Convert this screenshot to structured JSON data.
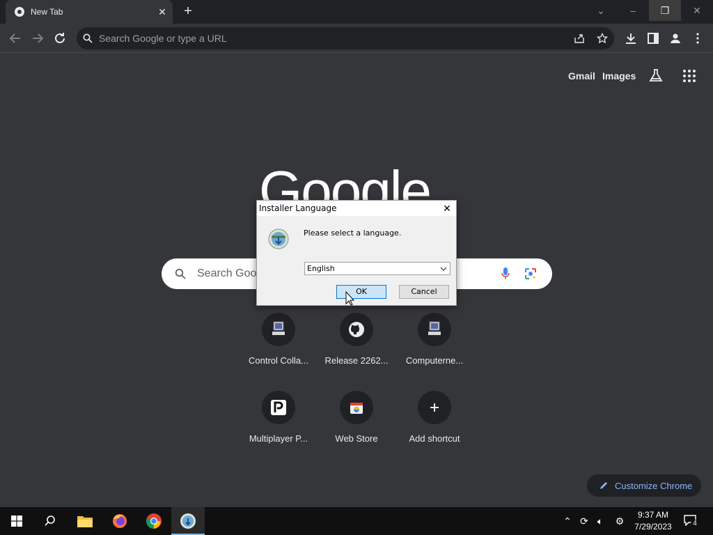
{
  "browser": {
    "tab": {
      "title": "New Tab"
    },
    "omnibox": {
      "placeholder": "Search Google or type a URL"
    }
  },
  "ntp": {
    "links": {
      "gmail": "Gmail",
      "images": "Images"
    },
    "logo_text": "Google",
    "search_placeholder": "Search Goog",
    "shortcuts": [
      {
        "label": "Control Colla...",
        "icon": "monitor-icon"
      },
      {
        "label": "Release 2262...",
        "icon": "github-icon"
      },
      {
        "label": "Computerne...",
        "icon": "monitor-icon"
      },
      {
        "label": "Multiplayer P...",
        "icon": "p-logo-icon"
      },
      {
        "label": "Web Store",
        "icon": "web-store-icon"
      },
      {
        "label": "Add shortcut",
        "icon": "plus-icon"
      }
    ],
    "customize_label": "Customize Chrome"
  },
  "dialog": {
    "title": "Installer Language",
    "message": "Please select a language.",
    "selected_language": "English",
    "ok_label": "OK",
    "cancel_label": "Cancel"
  },
  "taskbar": {
    "time": "9:37 AM",
    "date": "7/29/2023",
    "notification_count": "4"
  },
  "colors": {
    "ntp_background": "#35363a",
    "tabstrip": "#202124",
    "accent_link": "#8ab4f8",
    "taskbar": "#101010",
    "dialog_default_button": "#cce4f7"
  }
}
